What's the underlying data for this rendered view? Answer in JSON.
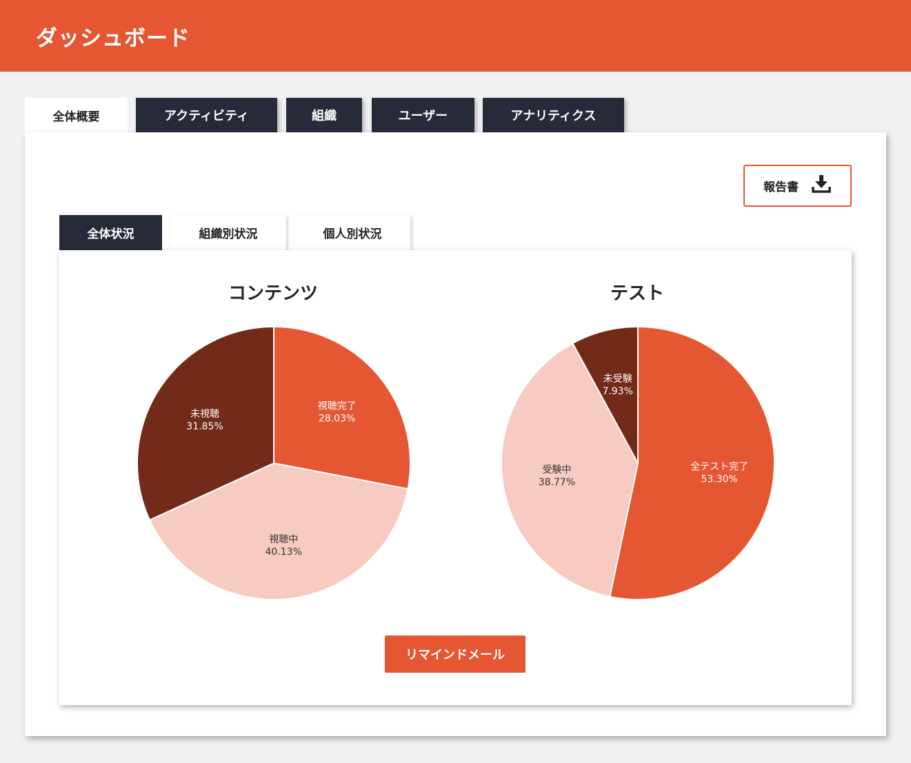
{
  "header": {
    "title": "ダッシュボード"
  },
  "main_tabs": [
    {
      "label": "全体概要",
      "active": true
    },
    {
      "label": "アクティビティ",
      "active": false
    },
    {
      "label": "組織",
      "active": false
    },
    {
      "label": "ユーザー",
      "active": false
    },
    {
      "label": "アナリティクス",
      "active": false
    }
  ],
  "toolbar": {
    "report_label": "報告書",
    "report_icon": "download-icon"
  },
  "sub_tabs": [
    {
      "label": "全体状況",
      "active": true
    },
    {
      "label": "組織別状況",
      "active": false
    },
    {
      "label": "個人別状況",
      "active": false
    }
  ],
  "colors": {
    "accent": "#e55633",
    "dark": "#272a38",
    "brown": "#722a19",
    "pink": "#f7cbc1"
  },
  "chart_data": [
    {
      "type": "pie",
      "title": "コンテンツ",
      "slices": [
        {
          "label": "視聴完了",
          "value": 28.03,
          "display": "28.03%",
          "color": "#e55633",
          "text_color": "#ffffff"
        },
        {
          "label": "視聴中",
          "value": 40.13,
          "display": "40.13%",
          "color": "#f7cbc1",
          "text_color": "#333333"
        },
        {
          "label": "未視聴",
          "value": 31.85,
          "display": "31.85%",
          "color": "#722a19",
          "text_color": "#ffffff"
        }
      ]
    },
    {
      "type": "pie",
      "title": "テスト",
      "slices": [
        {
          "label": "全テスト完了",
          "value": 53.3,
          "display": "53.30%",
          "color": "#e55633",
          "text_color": "#ffffff"
        },
        {
          "label": "受験中",
          "value": 38.77,
          "display": "38.77%",
          "color": "#f7cbc1",
          "text_color": "#333333"
        },
        {
          "label": "未受験",
          "value": 7.93,
          "display": "7.93%",
          "color": "#722a19",
          "text_color": "#ffffff"
        }
      ]
    }
  ],
  "remind_button": {
    "label": "リマインドメール"
  }
}
